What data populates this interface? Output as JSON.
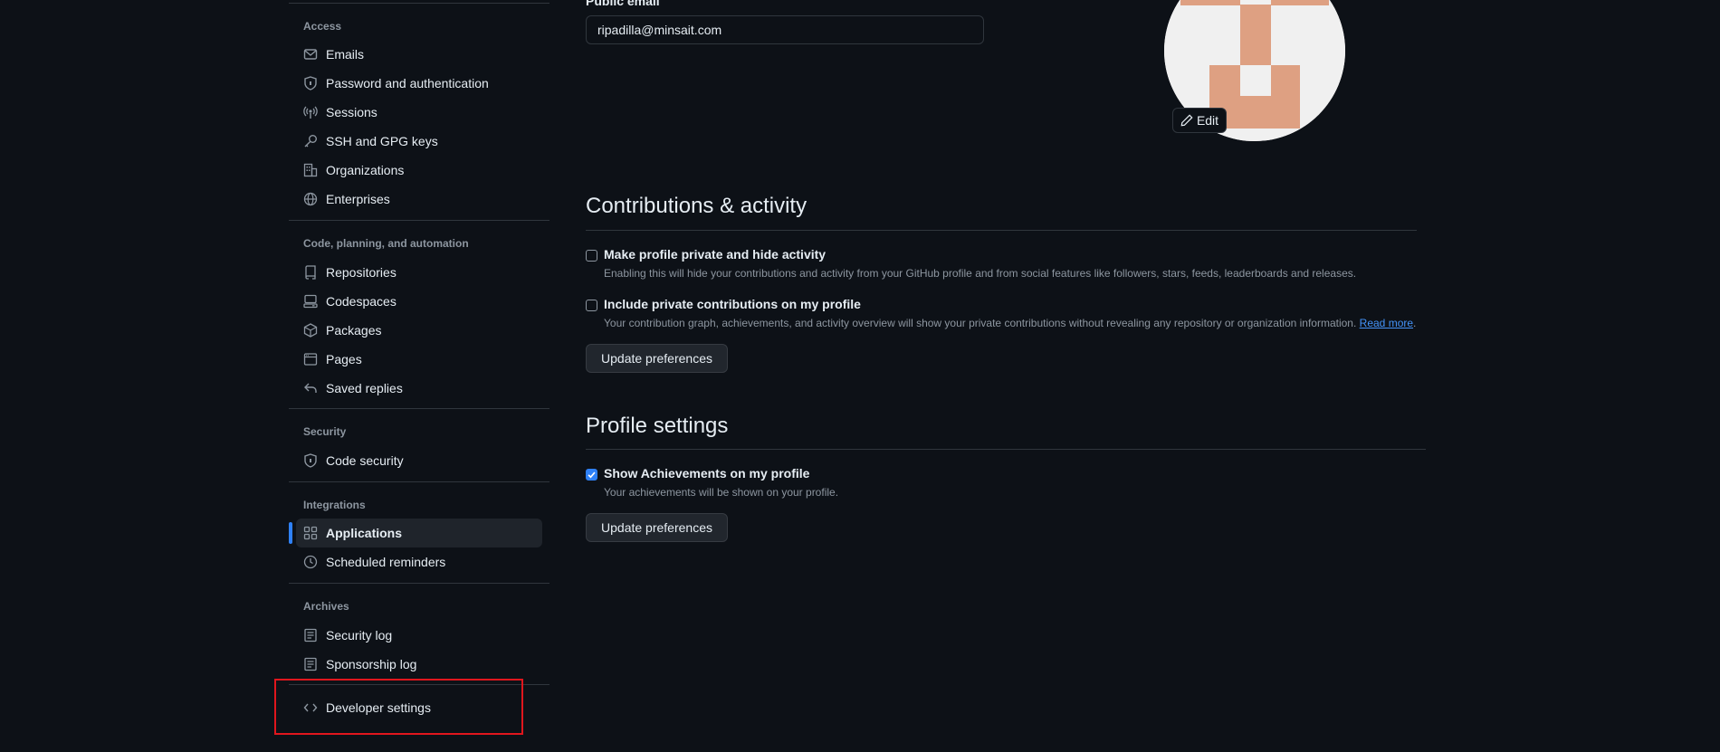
{
  "sidebar": {
    "groups": [
      {
        "title": "Access",
        "items": [
          {
            "label": "Emails",
            "icon": "mail-icon"
          },
          {
            "label": "Password and authentication",
            "icon": "shield-lock-icon"
          },
          {
            "label": "Sessions",
            "icon": "broadcast-icon"
          },
          {
            "label": "SSH and GPG keys",
            "icon": "key-icon"
          },
          {
            "label": "Organizations",
            "icon": "organization-icon"
          },
          {
            "label": "Enterprises",
            "icon": "globe-icon"
          }
        ]
      },
      {
        "title": "Code, planning, and automation",
        "items": [
          {
            "label": "Repositories",
            "icon": "repo-icon"
          },
          {
            "label": "Codespaces",
            "icon": "codespaces-icon"
          },
          {
            "label": "Packages",
            "icon": "package-icon"
          },
          {
            "label": "Pages",
            "icon": "browser-icon"
          },
          {
            "label": "Saved replies",
            "icon": "reply-icon"
          }
        ]
      },
      {
        "title": "Security",
        "items": [
          {
            "label": "Code security",
            "icon": "shield-lock-icon"
          }
        ]
      },
      {
        "title": "Integrations",
        "items": [
          {
            "label": "Applications",
            "icon": "apps-icon",
            "active": true
          },
          {
            "label": "Scheduled reminders",
            "icon": "clock-icon"
          }
        ]
      },
      {
        "title": "Archives",
        "items": [
          {
            "label": "Security log",
            "icon": "log-icon"
          },
          {
            "label": "Sponsorship log",
            "icon": "log-icon"
          }
        ]
      }
    ],
    "developer_settings": {
      "label": "Developer settings",
      "icon": "code-icon"
    }
  },
  "profile": {
    "public_email_label": "Public email",
    "public_email_value": "ripadilla@minsait.com",
    "edit_label": "Edit",
    "avatar_colors": {
      "background": "#f0f0f0",
      "blocks": "#dea082"
    }
  },
  "contributions": {
    "heading": "Contributions & activity",
    "options": [
      {
        "label": "Make profile private and hide activity",
        "note": "Enabling this will hide your contributions and activity from your GitHub profile and from social features like followers, stars, feeds, leaderboards and releases.",
        "checked": false
      },
      {
        "label": "Include private contributions on my profile",
        "note": "Your contribution graph, achievements, and activity overview will show your private contributions without revealing any repository or organization information.",
        "link": "Read more",
        "note_end": ".",
        "checked": false
      }
    ],
    "button": "Update preferences"
  },
  "profile_settings": {
    "heading": "Profile settings",
    "option": {
      "label": "Show Achievements on my profile",
      "note": "Your achievements will be shown on your profile.",
      "checked": true
    },
    "button": "Update preferences"
  },
  "colors": {
    "accent": "#2f81f7",
    "highlight_box": "#e0161d",
    "background": "#0d1117"
  }
}
